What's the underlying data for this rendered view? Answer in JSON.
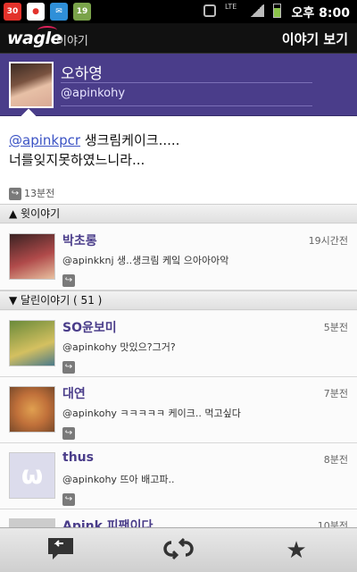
{
  "status_bar": {
    "apps": [
      {
        "name": "calendar-app-icon",
        "text": "30",
        "color": "#e3322b"
      },
      {
        "name": "rabbit-app-icon",
        "text": "",
        "color": "#ffffff"
      },
      {
        "name": "message-app-icon",
        "text": "",
        "color": "#2f8fd8"
      },
      {
        "name": "note-app-icon",
        "text": "19",
        "color": "#7aa34a"
      }
    ],
    "time": "오후 8:00",
    "network": "LTE"
  },
  "header": {
    "logo": "wagle",
    "logo_sub": "이야기",
    "title": "이야기 보기"
  },
  "profile": {
    "name": "오하영",
    "handle": "@apinkohy"
  },
  "post": {
    "mention": "@apinkpcr",
    "line1": " 생크림케이크.....",
    "line2": "너를잊지못하였느니라...",
    "time": "13분전"
  },
  "sections": {
    "parent": "▲ 윗이야기",
    "replies": "▼ 달린이야기 ( 51 )"
  },
  "parent_item": {
    "name": "박초롱",
    "time": "19시간전",
    "text": "@apinkknj 생..생크림 케잌 으아아아악"
  },
  "replies": [
    {
      "name": "SO윤보미",
      "time": "5분전",
      "text": "@apinkohy 맛있으?그거?",
      "avatar_color": "#6a8a3a"
    },
    {
      "name": "대연",
      "time": "7분전",
      "text": "@apinkohy ㅋㅋㅋㅋㅋ 케이크.. 먹고싶다",
      "avatar_color": "#c0803a"
    },
    {
      "name": "thus",
      "time": "8분전",
      "text": "@apinkohy 뜨아 배고파..",
      "avatar_color": "#dcdcec"
    },
    {
      "name": "Apink 피팬이다",
      "time": "10분전",
      "text": "",
      "avatar_color": "#cccccc"
    }
  ],
  "bottom_bar": {
    "reply_icon": "reply-icon",
    "reshare_icon": "reshare-icon",
    "favorite_icon": "star-icon"
  }
}
